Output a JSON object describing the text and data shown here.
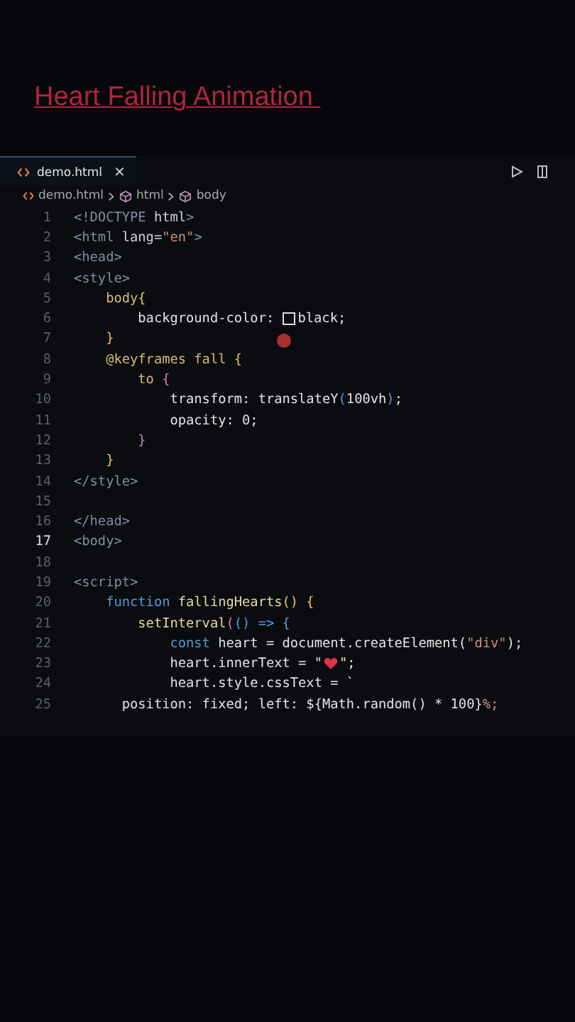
{
  "title": "Heart Falling Animation ",
  "tab": {
    "label": "demo.html",
    "close": "×",
    "selected": true
  },
  "breadcrumb": [
    "demo.html",
    "html",
    "body"
  ],
  "editor": {
    "lines": [
      {
        "n": "1",
        "current": false,
        "tokens": [
          {
            "t": "<!DOCTYPE ",
            "kind": "tag"
          },
          {
            "t": "html",
            "kind": "attr"
          },
          {
            "t": ">",
            "kind": "tag"
          }
        ]
      },
      {
        "n": "2",
        "current": false,
        "tokens": [
          {
            "t": "<html ",
            "kind": "tag"
          },
          {
            "t": "lang",
            "kind": "attr"
          },
          {
            "t": "=",
            "kind": "plain"
          },
          {
            "t": "\"en\"",
            "kind": "str"
          },
          {
            "t": ">",
            "kind": "tag"
          }
        ]
      },
      {
        "n": "3",
        "current": false,
        "tokens": [
          {
            "t": "<head>",
            "kind": "tag"
          }
        ]
      },
      {
        "n": "4",
        "current": false,
        "tokens": [
          {
            "t": "<style>",
            "kind": "tag"
          }
        ]
      },
      {
        "n": "5",
        "current": false,
        "tokens": [
          {
            "t": "    body",
            "kind": "sel"
          },
          {
            "t": "{",
            "kind": "punc"
          }
        ]
      },
      {
        "n": "6",
        "current": false,
        "tokens": [
          {
            "t": "        background-color: ",
            "kind": "prop"
          },
          {
            "kind": "swatch"
          },
          {
            "t": "black;",
            "kind": "prop"
          }
        ]
      },
      {
        "n": "7",
        "current": false,
        "tokens": [
          {
            "t": "    }",
            "kind": "punc"
          }
        ]
      },
      {
        "n": "8",
        "current": false,
        "tokens": [
          {
            "t": "    @keyframes fall ",
            "kind": "sel"
          },
          {
            "t": "{",
            "kind": "punc"
          }
        ]
      },
      {
        "n": "9",
        "current": false,
        "tokens": [
          {
            "t": "        to ",
            "kind": "sel"
          },
          {
            "t": "{",
            "kind": "punc2"
          }
        ]
      },
      {
        "n": "10",
        "current": false,
        "tokens": [
          {
            "t": "            transform: translateY",
            "kind": "prop"
          },
          {
            "t": "(",
            "kind": "paren"
          },
          {
            "t": "100vh",
            "kind": "prop"
          },
          {
            "t": ")",
            "kind": "paren"
          },
          {
            "t": ";",
            "kind": "prop"
          }
        ]
      },
      {
        "n": "11",
        "current": false,
        "tokens": [
          {
            "t": "            opacity: 0;",
            "kind": "prop"
          }
        ]
      },
      {
        "n": "12",
        "current": false,
        "tokens": [
          {
            "t": "        }",
            "kind": "punc2"
          }
        ]
      },
      {
        "n": "13",
        "current": false,
        "tokens": [
          {
            "t": "    }",
            "kind": "punc"
          }
        ]
      },
      {
        "n": "14",
        "current": false,
        "tokens": [
          {
            "t": "</style>",
            "kind": "tag"
          }
        ]
      },
      {
        "n": "15",
        "current": false
      },
      {
        "n": "16",
        "current": false,
        "tokens": [
          {
            "t": "</head>",
            "kind": "tag"
          }
        ]
      },
      {
        "n": "17",
        "current": true,
        "tokens": [
          {
            "t": "<body>",
            "kind": "tag"
          }
        ]
      },
      {
        "n": "18",
        "current": false
      },
      {
        "n": "19",
        "current": false,
        "tokens": [
          {
            "t": "<script>",
            "kind": "tag"
          }
        ]
      },
      {
        "n": "20",
        "current": false,
        "tokens": [
          {
            "t": "    function ",
            "kind": "kw"
          },
          {
            "t": "fallingHearts",
            "kind": "fn"
          },
          {
            "t": "() {",
            "kind": "punc"
          }
        ]
      },
      {
        "n": "21",
        "current": false,
        "tokens": [
          {
            "t": "        setInterval",
            "kind": "fn"
          },
          {
            "t": "(",
            "kind": "punc2"
          },
          {
            "t": "() => {",
            "kind": "paren"
          }
        ]
      },
      {
        "n": "22",
        "current": false,
        "tokens": [
          {
            "t": "            const ",
            "kind": "kw"
          },
          {
            "t": "heart = document.createElement(",
            "kind": "prop"
          },
          {
            "t": "\"div\"",
            "kind": "str"
          },
          {
            "t": ");",
            "kind": "prop"
          }
        ]
      },
      {
        "n": "23",
        "current": false,
        "tokens": [
          {
            "t": "            heart.innerText = \"",
            "kind": "prop"
          },
          {
            "kind": "heart"
          },
          {
            "t": "\";",
            "kind": "prop"
          }
        ]
      },
      {
        "n": "24",
        "current": false,
        "tokens": [
          {
            "t": "            heart.style.cssText = `",
            "kind": "prop"
          }
        ]
      },
      {
        "n": "25",
        "current": false,
        "tokens": [
          {
            "t": "      position: fixed; left: ${Math.random() * 100}",
            "kind": "prop"
          },
          {
            "t": "%;",
            "kind": "str"
          }
        ]
      }
    ]
  }
}
